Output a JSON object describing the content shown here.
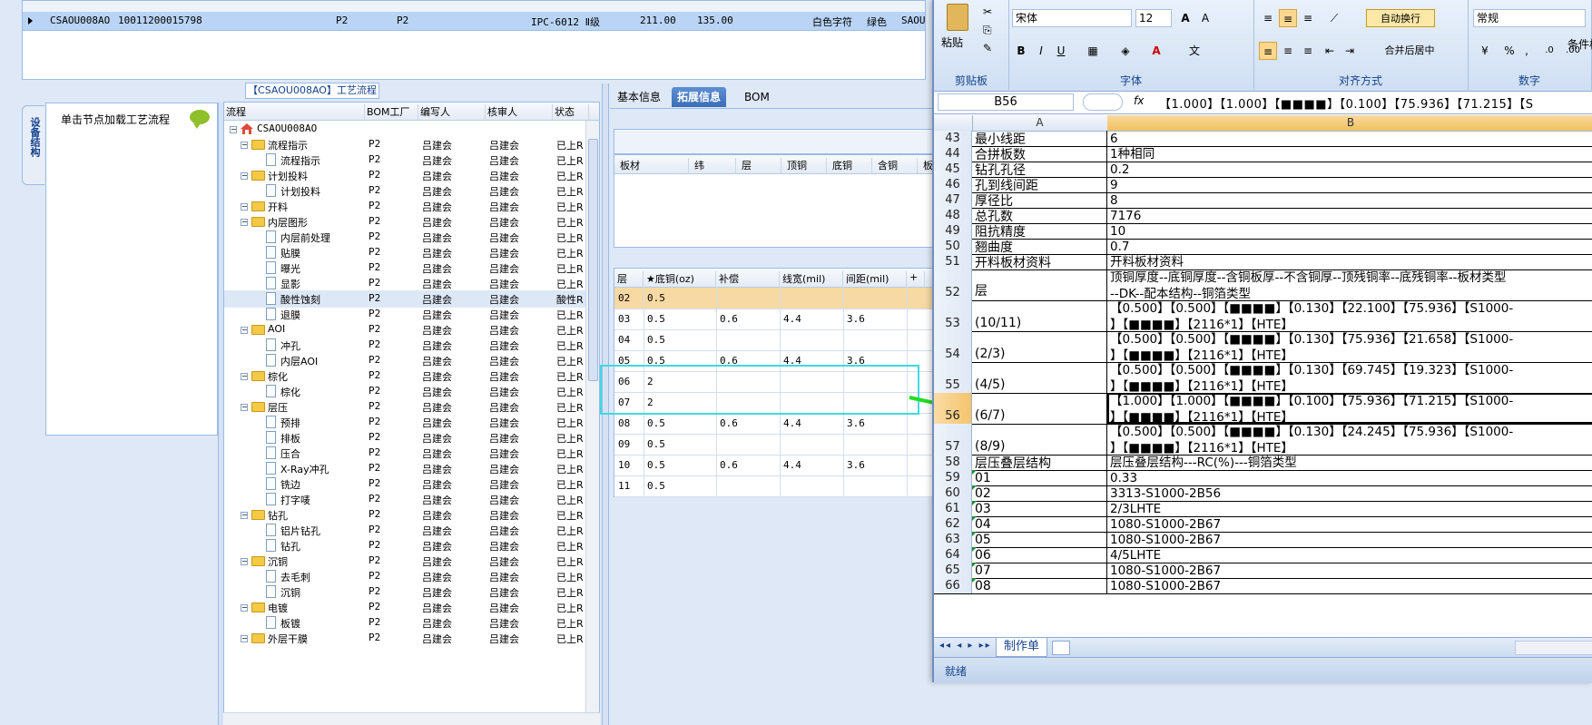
{
  "top_grid": {
    "row": {
      "code": "CSAOU008AO",
      "number": "10011200015798",
      "f1": "P2",
      "f2": "P2",
      "grade": "IPC-6012 Ⅱ级",
      "v1": "211.00",
      "v2": "135.00",
      "char_color": "白色字符",
      "mask_color": "绿色",
      "tail": "SAOU"
    }
  },
  "left_panel": {
    "header": "【CSAOU008AO】工艺流程",
    "vertical_tab": "设备结构",
    "prompt": "单击节点加载工艺流程"
  },
  "tree_grid": {
    "columns": [
      "流程",
      "BOM工厂",
      "编写人",
      "核审人",
      "状态"
    ],
    "root": "CSAOU008AO",
    "rows": [
      {
        "name": "流程指示",
        "level": 1,
        "folder": true,
        "bom": "P2",
        "writer": "吕建会",
        "auditor": "吕建会",
        "status": "已上R"
      },
      {
        "name": "流程指示",
        "level": 2,
        "folder": false,
        "bom": "P2",
        "writer": "吕建会",
        "auditor": "吕建会",
        "status": "已上R"
      },
      {
        "name": "计划投料",
        "level": 1,
        "folder": true,
        "bom": "P2",
        "writer": "吕建会",
        "auditor": "吕建会",
        "status": "已上R"
      },
      {
        "name": "计划投料",
        "level": 2,
        "folder": false,
        "bom": "P2",
        "writer": "吕建会",
        "auditor": "吕建会",
        "status": "已上R"
      },
      {
        "name": "开料",
        "level": 1,
        "folder": true,
        "bom": "P2",
        "writer": "吕建会",
        "auditor": "吕建会",
        "status": "已上R"
      },
      {
        "name": "内层图形",
        "level": 1,
        "folder": true,
        "bom": "P2",
        "writer": "吕建会",
        "auditor": "吕建会",
        "status": "已上R"
      },
      {
        "name": "内层前处理",
        "level": 2,
        "folder": false,
        "bom": "P2",
        "writer": "吕建会",
        "auditor": "吕建会",
        "status": "已上R"
      },
      {
        "name": "贴膜",
        "level": 2,
        "folder": false,
        "bom": "P2",
        "writer": "吕建会",
        "auditor": "吕建会",
        "status": "已上R"
      },
      {
        "name": "曝光",
        "level": 2,
        "folder": false,
        "bom": "P2",
        "writer": "吕建会",
        "auditor": "吕建会",
        "status": "已上R"
      },
      {
        "name": "显影",
        "level": 2,
        "folder": false,
        "bom": "P2",
        "writer": "吕建会",
        "auditor": "吕建会",
        "status": "已上R"
      },
      {
        "name": "酸性蚀刻",
        "level": 2,
        "folder": false,
        "bom": "P2",
        "writer": "吕建会",
        "auditor": "吕建会",
        "status": "酸性R"
      },
      {
        "name": "退膜",
        "level": 2,
        "folder": false,
        "bom": "P2",
        "writer": "吕建会",
        "auditor": "吕建会",
        "status": "已上R"
      },
      {
        "name": "AOI",
        "level": 1,
        "folder": true,
        "bom": "P2",
        "writer": "吕建会",
        "auditor": "吕建会",
        "status": "已上R"
      },
      {
        "name": "冲孔",
        "level": 2,
        "folder": false,
        "bom": "P2",
        "writer": "吕建会",
        "auditor": "吕建会",
        "status": "已上R"
      },
      {
        "name": "内层AOI",
        "level": 2,
        "folder": false,
        "bom": "P2",
        "writer": "吕建会",
        "auditor": "吕建会",
        "status": "已上R"
      },
      {
        "name": "棕化",
        "level": 1,
        "folder": true,
        "bom": "P2",
        "writer": "吕建会",
        "auditor": "吕建会",
        "status": "已上R"
      },
      {
        "name": "棕化",
        "level": 2,
        "folder": false,
        "bom": "P2",
        "writer": "吕建会",
        "auditor": "吕建会",
        "status": "已上R"
      },
      {
        "name": "层压",
        "level": 1,
        "folder": true,
        "bom": "P2",
        "writer": "吕建会",
        "auditor": "吕建会",
        "status": "已上R"
      },
      {
        "name": "预排",
        "level": 2,
        "folder": false,
        "bom": "P2",
        "writer": "吕建会",
        "auditor": "吕建会",
        "status": "已上R"
      },
      {
        "name": "排板",
        "level": 2,
        "folder": false,
        "bom": "P2",
        "writer": "吕建会",
        "auditor": "吕建会",
        "status": "已上R"
      },
      {
        "name": "压合",
        "level": 2,
        "folder": false,
        "bom": "P2",
        "writer": "吕建会",
        "auditor": "吕建会",
        "status": "已上R"
      },
      {
        "name": "X-Ray冲孔",
        "level": 2,
        "folder": false,
        "bom": "P2",
        "writer": "吕建会",
        "auditor": "吕建会",
        "status": "已上R"
      },
      {
        "name": "铣边",
        "level": 2,
        "folder": false,
        "bom": "P2",
        "writer": "吕建会",
        "auditor": "吕建会",
        "status": "已上R"
      },
      {
        "name": "打字唛",
        "level": 2,
        "folder": false,
        "bom": "P2",
        "writer": "吕建会",
        "auditor": "吕建会",
        "status": "已上R"
      },
      {
        "name": "钻孔",
        "level": 1,
        "folder": true,
        "bom": "P2",
        "writer": "吕建会",
        "auditor": "吕建会",
        "status": "已上R"
      },
      {
        "name": "铝片钻孔",
        "level": 2,
        "folder": false,
        "bom": "P2",
        "writer": "吕建会",
        "auditor": "吕建会",
        "status": "已上R"
      },
      {
        "name": "钻孔",
        "level": 2,
        "folder": false,
        "bom": "P2",
        "writer": "吕建会",
        "auditor": "吕建会",
        "status": "已上R"
      },
      {
        "name": "沉铜",
        "level": 1,
        "folder": true,
        "bom": "P2",
        "writer": "吕建会",
        "auditor": "吕建会",
        "status": "已上R"
      },
      {
        "name": "去毛刺",
        "level": 2,
        "folder": false,
        "bom": "P2",
        "writer": "吕建会",
        "auditor": "吕建会",
        "status": "已上R"
      },
      {
        "name": "沉铜",
        "level": 2,
        "folder": false,
        "bom": "P2",
        "writer": "吕建会",
        "auditor": "吕建会",
        "status": "已上R"
      },
      {
        "name": "电镀",
        "level": 1,
        "folder": true,
        "bom": "P2",
        "writer": "吕建会",
        "auditor": "吕建会",
        "status": "已上R"
      },
      {
        "name": "板镀",
        "level": 2,
        "folder": false,
        "bom": "P2",
        "writer": "吕建会",
        "auditor": "吕建会",
        "status": "已上R"
      },
      {
        "name": "外层干膜",
        "level": 1,
        "folder": true,
        "bom": "P2",
        "writer": "吕建会",
        "auditor": "吕建会",
        "status": "已上R"
      }
    ]
  },
  "mid_panel": {
    "tabs": [
      "基本信息",
      "拓展信息",
      "BOM"
    ],
    "active_tab": 1,
    "board_columns": [
      "板材",
      "纬",
      "层",
      "顶铜",
      "底铜",
      "含铜",
      "板"
    ],
    "layer_columns": [
      "层",
      "★底铜(oz)",
      "补偿",
      "线宽(mil)",
      "间距(mil)",
      "+"
    ],
    "layers": [
      {
        "id": "02",
        "base": "0.5",
        "comp": "",
        "width": "",
        "space": "",
        "hl": true
      },
      {
        "id": "03",
        "base": "0.5",
        "comp": "0.6",
        "width": "4.4",
        "space": "3.6"
      },
      {
        "id": "04",
        "base": "0.5",
        "comp": "",
        "width": "",
        "space": ""
      },
      {
        "id": "05",
        "base": "0.5",
        "comp": "0.6",
        "width": "4.4",
        "space": "3.6"
      },
      {
        "id": "06",
        "base": "2",
        "comp": "",
        "width": "",
        "space": ""
      },
      {
        "id": "07",
        "base": "2",
        "comp": "",
        "width": "",
        "space": ""
      },
      {
        "id": "08",
        "base": "0.5",
        "comp": "0.6",
        "width": "4.4",
        "space": "3.6"
      },
      {
        "id": "09",
        "base": "0.5",
        "comp": "",
        "width": "",
        "space": ""
      },
      {
        "id": "10",
        "base": "0.5",
        "comp": "0.6",
        "width": "4.4",
        "space": "3.6"
      },
      {
        "id": "11",
        "base": "0.5",
        "comp": "",
        "width": "",
        "space": ""
      }
    ]
  },
  "excel": {
    "ribbon": {
      "paste_label": "粘贴",
      "clipboard_title": "剪贴板",
      "font_name": "宋体",
      "font_size": "12",
      "font_title": "字体",
      "align_title": "对齐方式",
      "wrap_label": "自动换行",
      "merge_label": "合并后居中",
      "number_format": "常规",
      "number_title": "数字",
      "conditional_label": "条件格"
    },
    "name_box": "B56",
    "fx": "fx",
    "formula": "【1.000】【1.000】【■■■■】【0.100】【75.936】【71.215】【S",
    "col_a": "A",
    "col_b": "B",
    "rows": [
      {
        "n": "43",
        "a": "最小线距",
        "b": "6"
      },
      {
        "n": "44",
        "a": "合拼板数",
        "b": "1种相同"
      },
      {
        "n": "45",
        "a": "钻孔孔径",
        "b": "0.2"
      },
      {
        "n": "46",
        "a": "孔到线间距",
        "b": "9"
      },
      {
        "n": "47",
        "a": "厚径比",
        "b": "8"
      },
      {
        "n": "48",
        "a": "总孔数",
        "b": "7176"
      },
      {
        "n": "49",
        "a": "阻抗精度",
        "b": "10"
      },
      {
        "n": "50",
        "a": "翘曲度",
        "b": "0.7"
      },
      {
        "n": "51",
        "a": "开料板材资料",
        "b": "开料板材资料"
      },
      {
        "n": "52",
        "a": "层",
        "b": "顶铜厚度--底铜厚度--含铜板厚--不含铜厚--顶残铜率--底残铜率--板材类型\n--DK--配本结构--铜箔类型",
        "tall": true
      },
      {
        "n": "53",
        "a": "(10/11)",
        "b": "【0.500】【0.500】【■■■■】【0.130】【22.100】【75.936】【S1000-\n】【■■■■】【2116*1】【HTE】",
        "tall": true
      },
      {
        "n": "54",
        "a": "(2/3)",
        "b": "【0.500】【0.500】【■■■■】【0.130】【75.936】【21.658】【S1000-\n】【■■■■】【2116*1】【HTE】",
        "tall": true
      },
      {
        "n": "55",
        "a": "(4/5)",
        "b": "【0.500】【0.500】【■■■■】【0.130】【69.745】【19.323】【S1000-\n】【■■■■】【2116*1】【HTE】",
        "tall": true
      },
      {
        "n": "56",
        "a": "(6/7)",
        "b": "【1.000】【1.000】【■■■■】【0.100】【75.936】【71.215】【S1000-\n】【■■■■】【2116*1】【HTE】",
        "tall": true,
        "active": true
      },
      {
        "n": "57",
        "a": "(8/9)",
        "b": "【0.500】【0.500】【■■■■】【0.130】【24.245】【75.936】【S1000-\n】【■■■■】【2116*1】【HTE】",
        "tall": true
      },
      {
        "n": "58",
        "a": "层压叠层结构",
        "b": "层压叠层结构---RC(%)---铜箔类型"
      },
      {
        "n": "59",
        "a": "01",
        "b": "0.33",
        "tri": true
      },
      {
        "n": "60",
        "a": "02",
        "b": "3313-S1000-2B56",
        "tri": true
      },
      {
        "n": "61",
        "a": "03",
        "b": "2/3LHTE",
        "tri": true
      },
      {
        "n": "62",
        "a": "04",
        "b": "1080-S1000-2B67",
        "tri": true
      },
      {
        "n": "63",
        "a": "05",
        "b": "1080-S1000-2B67",
        "tri": true
      },
      {
        "n": "64",
        "a": "06",
        "b": "4/5LHTE",
        "tri": true
      },
      {
        "n": "65",
        "a": "07",
        "b": "1080-S1000-2B67",
        "tri": true
      },
      {
        "n": "66",
        "a": "08",
        "b": "1080-S1000-2B67",
        "tri": true
      }
    ],
    "sheet_tab": "制作单",
    "status": "就绪"
  }
}
